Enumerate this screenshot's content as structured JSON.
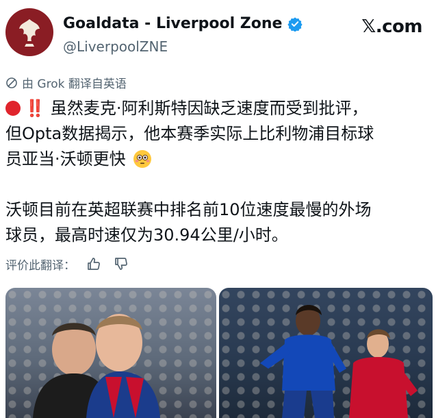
{
  "account": {
    "display_name": "Goaldata - Liverpool Zone",
    "handle": "@LiverpoolZNE",
    "avatar_icon": "liverbird-icon",
    "verified_icon": "verified-badge-icon",
    "accent_color": "#8a1d24"
  },
  "platform": {
    "logo_text": "𝕏.com"
  },
  "translation": {
    "notice": "由 Grok 翻译自英语",
    "rate_label": "评价此翻译："
  },
  "tweet": {
    "line1": "虽然麦克·阿利斯特因缺乏速度而受到批评，",
    "line2": "但Opta数据揭示，他本赛季实际上比利物浦目标球",
    "line3": "员亚当·沃顿更快",
    "line4": "沃顿目前在英超联赛中排名前10位速度最慢的外场",
    "line5": "球员，最高时速仅为30.94公里/小时。",
    "emoji_lead": "red-circle-icon",
    "emoji_bang": "‼️",
    "emoji_face": "flushed-face-icon"
  },
  "media": [
    {
      "name": "media-image-left",
      "icon": "photo-icon"
    },
    {
      "name": "media-image-right",
      "icon": "photo-icon"
    }
  ],
  "colors": {
    "text": "#0f1419",
    "muted": "#536471",
    "verified": "#1d9bf0",
    "alert": "#e0242c"
  }
}
